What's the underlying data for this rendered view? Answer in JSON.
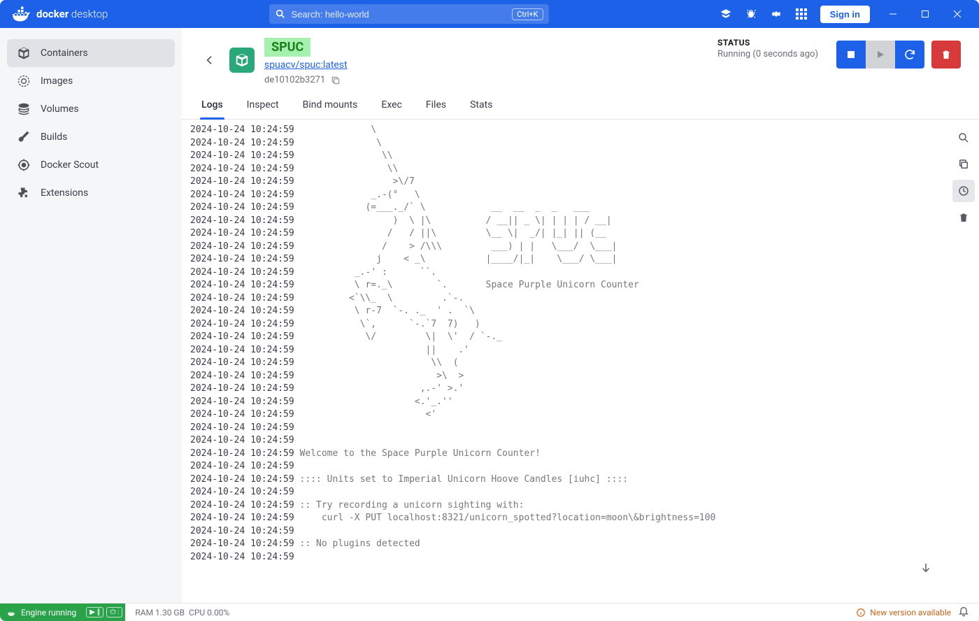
{
  "titlebar": {
    "app_name_bold": "docker",
    "app_name_thin": "desktop",
    "search_placeholder": "Search: hello-world",
    "kbd": "Ctrl+K",
    "signin": "Sign in"
  },
  "sidebar": {
    "items": [
      {
        "label": "Containers"
      },
      {
        "label": "Images"
      },
      {
        "label": "Volumes"
      },
      {
        "label": "Builds"
      },
      {
        "label": "Docker Scout"
      },
      {
        "label": "Extensions"
      }
    ]
  },
  "container": {
    "name": "SPUC",
    "image": "spuacv/spuc:latest",
    "short_id": "de10102b3271",
    "status_label": "STATUS",
    "status_text": "Running (0 seconds ago)"
  },
  "tabs": [
    "Logs",
    "Inspect",
    "Bind mounts",
    "Exec",
    "Files",
    "Stats"
  ],
  "logs": {
    "timestamp": "2024-10-24 10:24:59",
    "lines": [
      "             \\",
      "              \\",
      "               \\\\",
      "                \\\\",
      "                 >\\/7",
      "             _.-(°   \\",
      "            (=___._/` \\            __  __  _  _   ___",
      "                 )  \\ |\\          / __|| _ \\| | | | / __|",
      "                /   / ||\\         \\__ \\|  _/| |_| || (__",
      "               /    > /\\\\\\         ___) | |   \\___/  \\___|",
      "              j    < _\\           |____/|_|    \\___/ \\___|",
      "          _.-' :      ``.",
      "          \\ r=._\\        `.       Space Purple Unicorn Counter",
      "         <`\\\\_  \\         .`-.",
      "          \\ r-7  `-. ._  ' .  `\\",
      "           \\`,      `-.`7  7)   )",
      "            \\/         \\|  \\'  / `-._",
      "                       ||    .'",
      "                        \\\\  (",
      "                         >\\  >",
      "                      ,.-' >.'",
      "                     <.'_.''",
      "                       <'",
      "",
      "",
      "Welcome to the Space Purple Unicorn Counter!",
      "",
      ":::: Units set to Imperial Unicorn Hoove Candles [iuhc] ::::",
      "",
      ":: Try recording a unicorn sighting with:",
      "    curl -X PUT localhost:8321/unicorn_spotted?location=moon\\&brightness=100",
      "",
      ":: No plugins detected",
      ""
    ]
  },
  "statusbar": {
    "engine": "Engine running",
    "ram": "RAM 1.30 GB",
    "cpu": "CPU 0.00%",
    "update": "New version available"
  }
}
